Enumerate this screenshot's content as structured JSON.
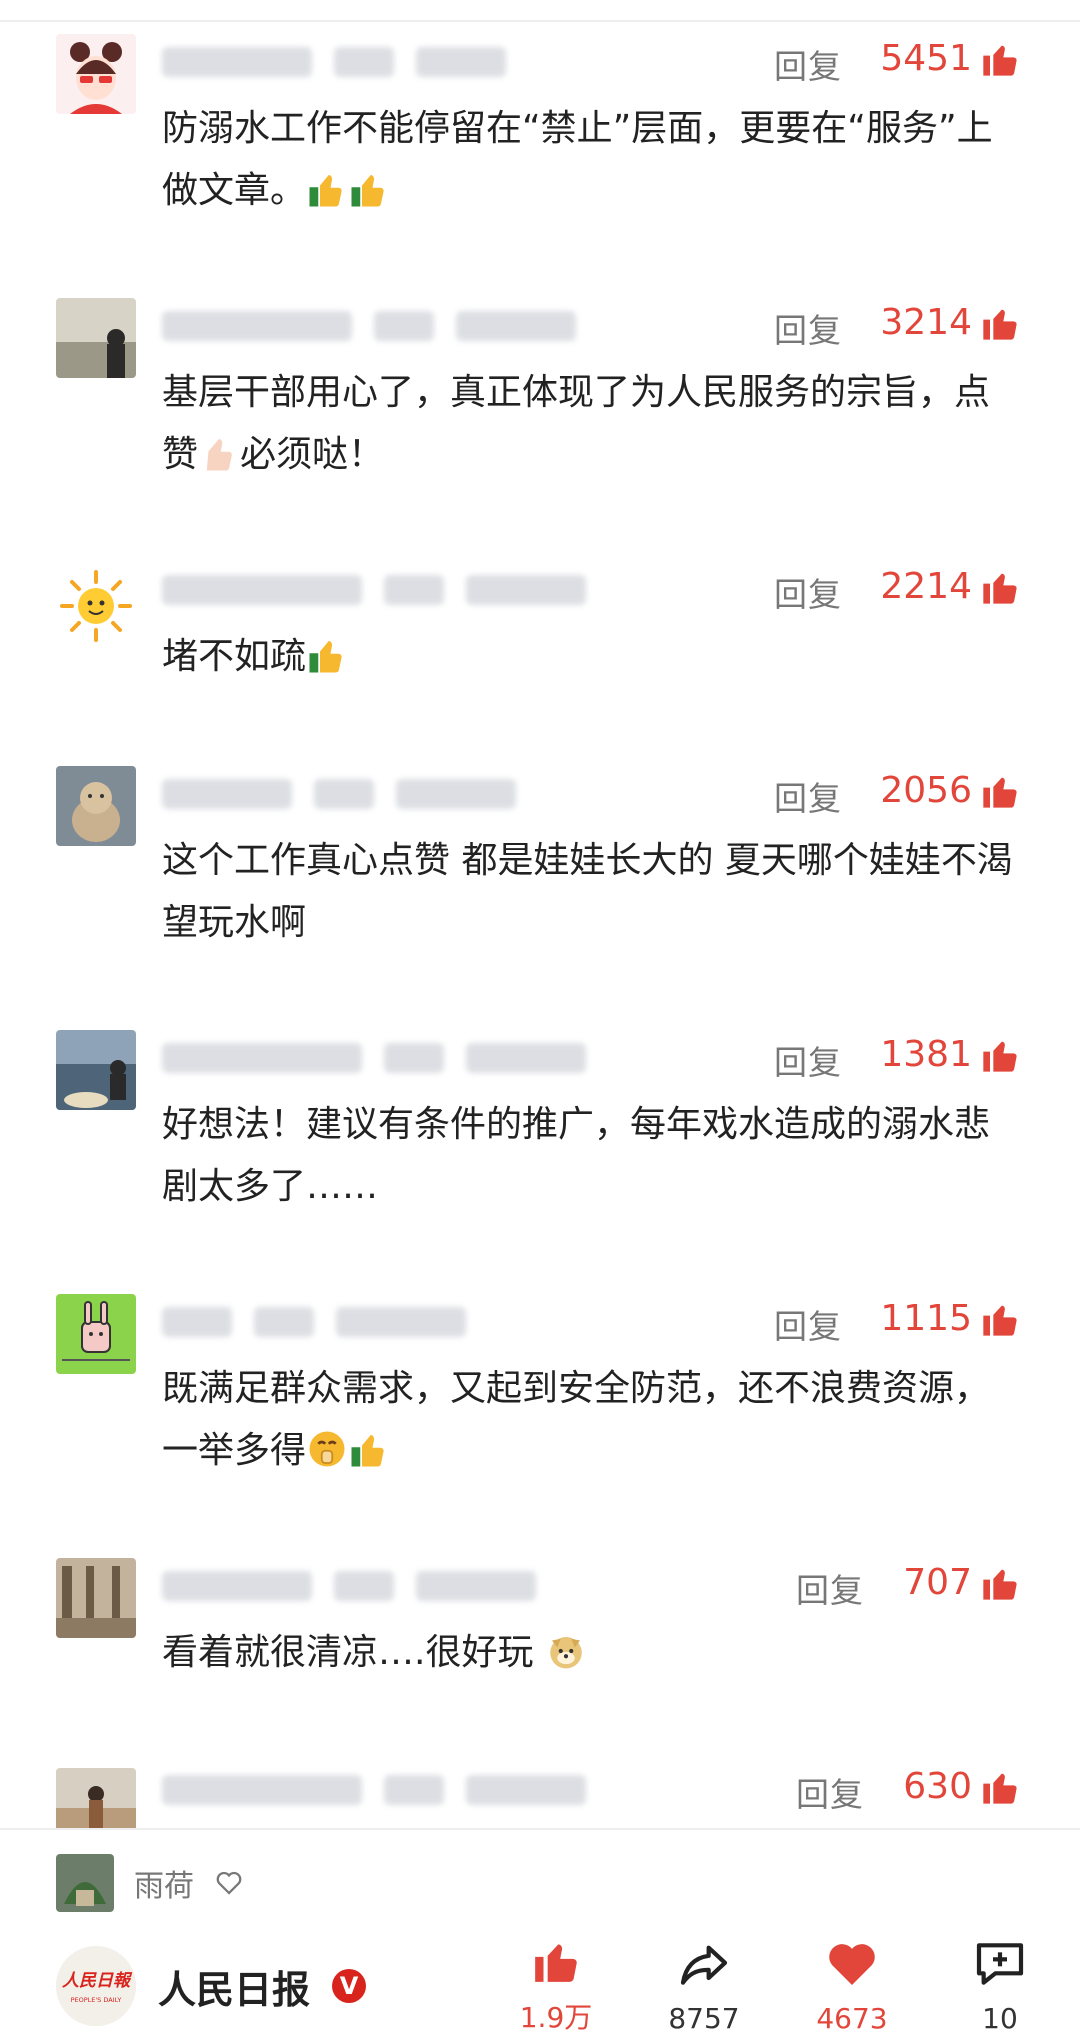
{
  "comments": [
    {
      "reply_label": "回复",
      "likes": "5451",
      "text": "防溺水工作不能停留在“禁止”层面，更要在“服务”上做文章。"
    },
    {
      "reply_label": "回复",
      "likes": "3214",
      "text": "基层干部用心了，真正体现了为人民服务的宗旨，点赞"
    },
    {
      "reply_label": "回复",
      "likes": "2214",
      "text": "堵不如疏"
    },
    {
      "reply_label": "回复",
      "likes": "2056",
      "text": "这个工作真心点赞 都是娃娃长大的 夏天哪个娃娃不渴望玩水啊"
    },
    {
      "reply_label": "回复",
      "likes": "1381",
      "text": "好想法！建议有条件的推广，每年戏水造成的溺水悲剧太多了……"
    },
    {
      "reply_label": "回复",
      "likes": "1115",
      "text": "既满足群众需求，又起到安全防范，还不浪费资源，一举多得"
    },
    {
      "reply_label": "回复",
      "likes": "707",
      "text": "看着就很清凉….很好玩"
    },
    {
      "reply_label": "回复",
      "likes": "630",
      "text": ""
    }
  ],
  "comment2_tail": "必须哒！",
  "bottom": {
    "user_name": "雨荷",
    "source_name": "人民日报",
    "verified_badge": "V",
    "logo_text": "人民日報",
    "logo_sub": "PEOPLE'S DAILY",
    "actions": [
      {
        "icon": "thumbs-up-icon",
        "count": "1.9万"
      },
      {
        "icon": "share-icon",
        "count": "8757"
      },
      {
        "icon": "heart-icon",
        "count": "4673"
      },
      {
        "icon": "comment-add-icon",
        "count": "10"
      }
    ]
  },
  "colors": {
    "accent": "#e2463a",
    "muted": "#777777",
    "text": "#222222"
  }
}
